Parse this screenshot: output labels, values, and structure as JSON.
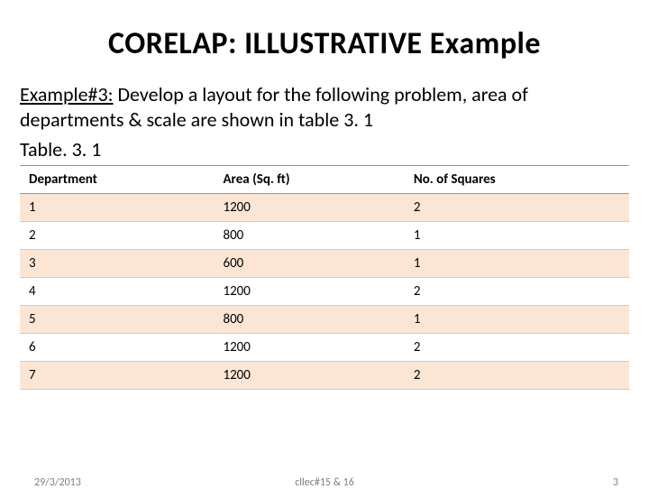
{
  "title": "CORELAP: ILLUSTRATIVE Example",
  "example_label": "Example#3:",
  "example_text": " Develop a layout for the following  problem, area of departments & scale are shown in table 3. 1",
  "table_label": "Table. 3. 1",
  "columns": [
    "Department",
    "Area (Sq. ft)",
    "No. of Squares"
  ],
  "rows": [
    {
      "c0": "1",
      "c1": "1200",
      "c2": "2"
    },
    {
      "c0": "2",
      "c1": "800",
      "c2": "1"
    },
    {
      "c0": "3",
      "c1": "600",
      "c2": "1"
    },
    {
      "c0": "4",
      "c1": "1200",
      "c2": "2"
    },
    {
      "c0": "5",
      "c1": "800",
      "c2": "1"
    },
    {
      "c0": "6",
      "c1": "1200",
      "c2": "2"
    },
    {
      "c0": "7",
      "c1": "1200",
      "c2": "2"
    }
  ],
  "footer": {
    "date": "29/3/2013",
    "ref": "cllec#15 & 16",
    "page": "3"
  },
  "chart_data": {
    "type": "table",
    "title": "Table. 3. 1",
    "columns": [
      "Department",
      "Area (Sq. ft)",
      "No. of Squares"
    ],
    "rows": [
      [
        1,
        1200,
        2
      ],
      [
        2,
        800,
        1
      ],
      [
        3,
        600,
        1
      ],
      [
        4,
        1200,
        2
      ],
      [
        5,
        800,
        1
      ],
      [
        6,
        1200,
        2
      ],
      [
        7,
        1200,
        2
      ]
    ]
  }
}
